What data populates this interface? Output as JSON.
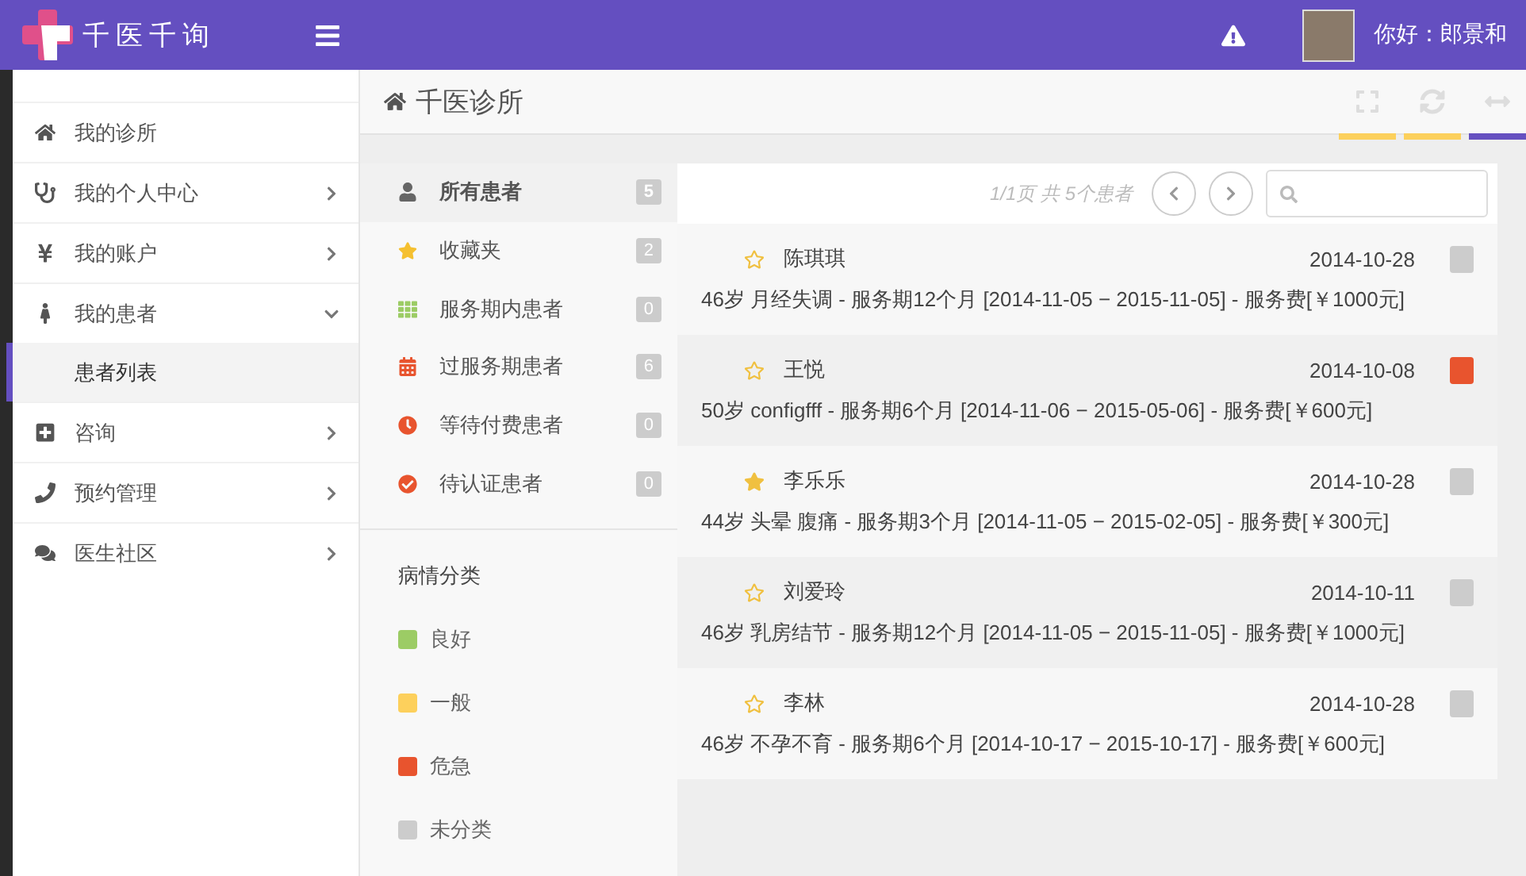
{
  "header": {
    "brand": "千医千询",
    "greeting": "你好：郎景和"
  },
  "sidebar": {
    "items": [
      {
        "label": "我的诊所",
        "has_children": false
      },
      {
        "label": "我的个人中心",
        "has_children": true,
        "expanded": false
      },
      {
        "label": "我的账户",
        "has_children": true,
        "expanded": false
      },
      {
        "label": "我的患者",
        "has_children": true,
        "expanded": true,
        "children": [
          {
            "label": "患者列表",
            "selected": true
          }
        ]
      },
      {
        "label": "咨询",
        "has_children": true,
        "expanded": false
      },
      {
        "label": "预约管理",
        "has_children": true,
        "expanded": false
      },
      {
        "label": "医生社区",
        "has_children": true,
        "expanded": false
      }
    ]
  },
  "breadcrumb": {
    "title": "千医诊所"
  },
  "tools": [
    {
      "kind": "fullscreen",
      "color": "#fcd05c"
    },
    {
      "kind": "refresh",
      "color": "#fcd05c"
    },
    {
      "kind": "collapse",
      "color": "#6650c0"
    }
  ],
  "filters": [
    {
      "label": "所有患者",
      "count": "5",
      "selected": true
    },
    {
      "label": "收藏夹",
      "count": "2",
      "selected": false
    },
    {
      "label": "服务期内患者",
      "count": "0",
      "selected": false
    },
    {
      "label": "过服务期患者",
      "count": "6",
      "selected": false
    },
    {
      "label": "等待付费患者",
      "count": "0",
      "selected": false
    },
    {
      "label": "待认证患者",
      "count": "0",
      "selected": false
    }
  ],
  "categories": {
    "title": "病情分类",
    "items": [
      {
        "label": "良好",
        "color": "#9ccc65"
      },
      {
        "label": "一般",
        "color": "#fdd05c"
      },
      {
        "label": "危急",
        "color": "#e8542e"
      },
      {
        "label": "未分类",
        "color": "#cccccc"
      }
    ]
  },
  "pager": {
    "summary": "1/1页 共 5个患者"
  },
  "patients": [
    {
      "name": "陈琪琪",
      "date": "2014-10-28",
      "detail": "46岁 月经失调 - 服务期12个月 [2014-11-05 − 2015-11-05] - 服务费[￥1000元]",
      "favorite": false,
      "color": "#cccccc"
    },
    {
      "name": "王悦",
      "date": "2014-10-08",
      "detail": "50岁 configfff - 服务期6个月 [2014-11-06 − 2015-05-06] - 服务费[￥600元]",
      "favorite": false,
      "color": "#e8542e"
    },
    {
      "name": "李乐乐",
      "date": "2014-10-28",
      "detail": "44岁 头晕 腹痛 - 服务期3个月 [2014-11-05 − 2015-02-05] - 服务费[￥300元]",
      "favorite": true,
      "color": "#cccccc"
    },
    {
      "name": "刘爱玲",
      "date": "2014-10-11",
      "detail": "46岁 乳房结节 - 服务期12个月 [2014-11-05 − 2015-11-05] - 服务费[￥1000元]",
      "favorite": false,
      "color": "#cccccc"
    },
    {
      "name": "李林",
      "date": "2014-10-28",
      "detail": "46岁 不孕不育 - 服务期6个月 [2014-10-17 − 2015-10-17] - 服务费[￥600元]",
      "favorite": false,
      "color": "#cccccc"
    }
  ]
}
